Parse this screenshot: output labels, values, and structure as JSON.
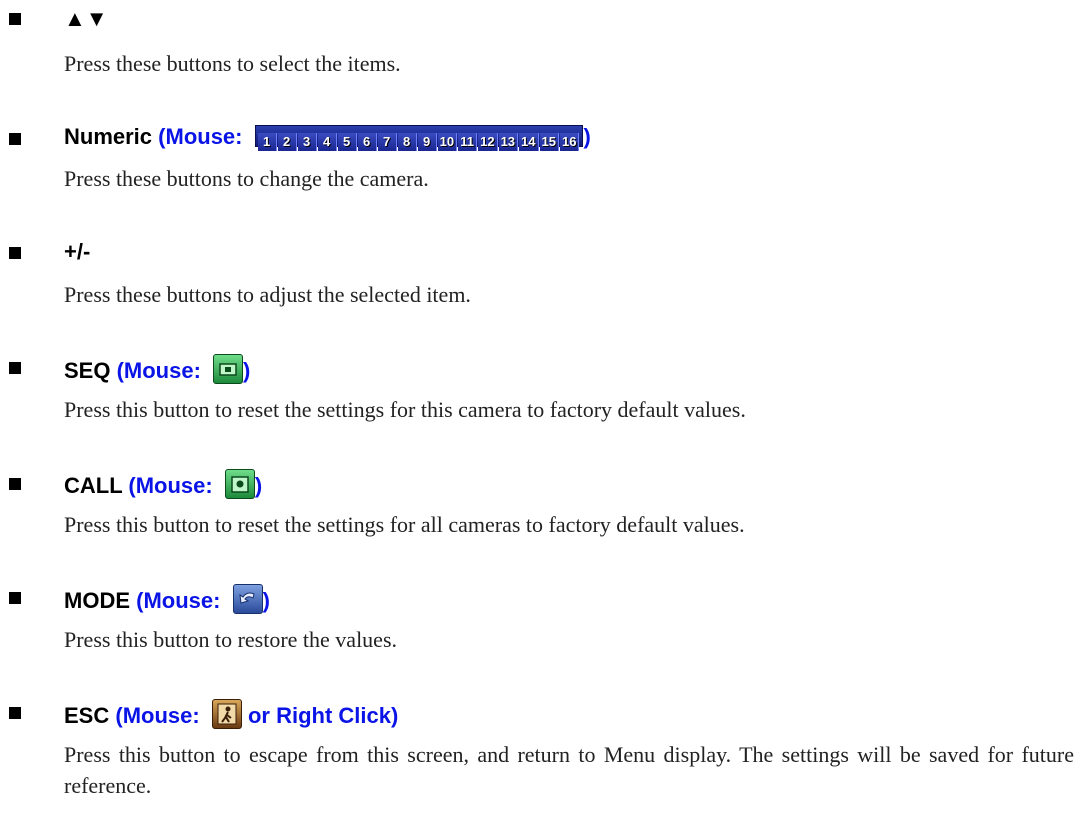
{
  "items": [
    {
      "title": "▲▼",
      "mouse_prefix": "",
      "mouse_suffix": "",
      "desc": "Press these buttons to select the items."
    },
    {
      "title": "Numeric",
      "mouse_prefix": "(Mouse:",
      "mouse_suffix": ")",
      "desc": "Press these buttons to change the camera."
    },
    {
      "title": "+/-",
      "mouse_prefix": "",
      "mouse_suffix": "",
      "desc": "Press these buttons to adjust the selected item."
    },
    {
      "title": "SEQ",
      "mouse_prefix": "(Mouse:",
      "mouse_suffix": ")",
      "desc": "Press this button to reset the settings for this camera to factory default values."
    },
    {
      "title": "CALL",
      "mouse_prefix": "(Mouse:",
      "mouse_suffix": ")",
      "desc": "Press this button to reset the settings for all cameras to factory default values."
    },
    {
      "title": "MODE",
      "mouse_prefix": "(Mouse:",
      "mouse_suffix": ")",
      "desc": "Press this button to restore the values."
    },
    {
      "title": "ESC",
      "mouse_prefix": "(Mouse:",
      "mouse_suffix": "or Right Click)",
      "desc": "Press this button to escape from this screen, and return to Menu display.  The settings will be saved for future reference."
    }
  ],
  "numeric_buttons": [
    "1",
    "2",
    "3",
    "4",
    "5",
    "6",
    "7",
    "8",
    "9",
    "10",
    "11",
    "12",
    "13",
    "14",
    "15",
    "16"
  ],
  "colors": {
    "mouse_text": "#0a14e6",
    "bullet": "#000000"
  },
  "icons": {
    "seq": "seq-icon",
    "call": "call-icon",
    "mode": "mode-icon",
    "esc": "esc-icon"
  }
}
